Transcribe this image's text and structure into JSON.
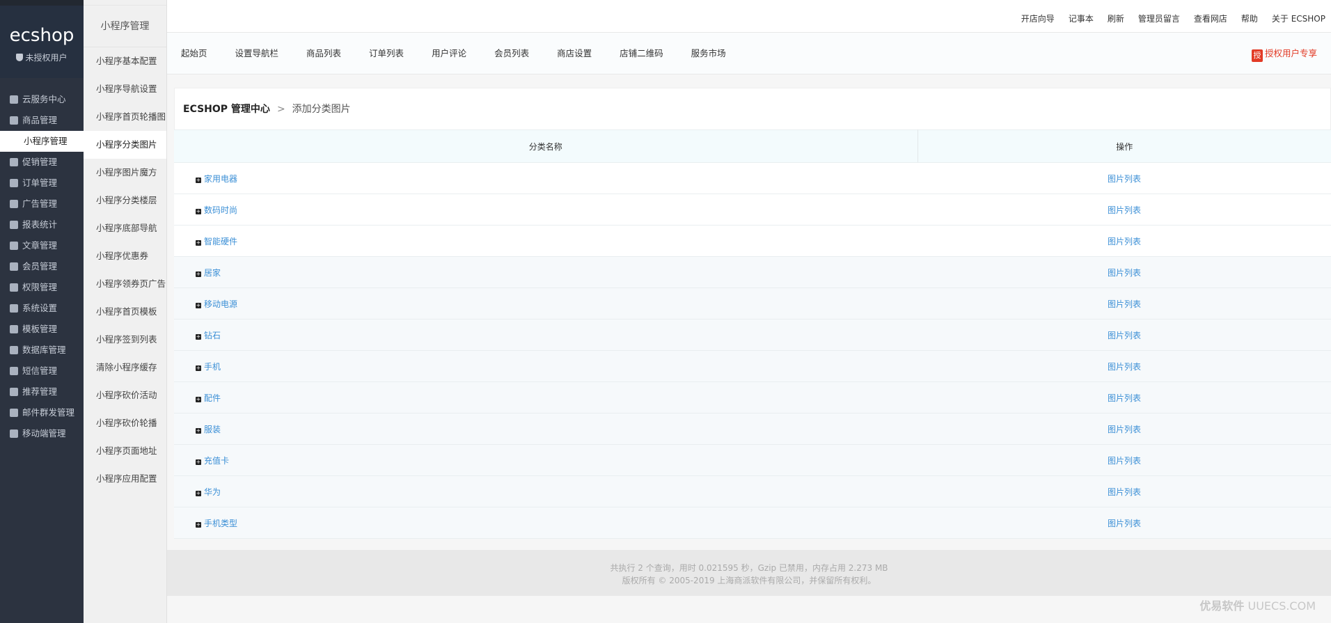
{
  "sidebar": {
    "logo": "ecshop",
    "user": "未授权用户",
    "items": [
      {
        "label": "云服务中心",
        "icon": "cloud-icon"
      },
      {
        "label": "商品管理",
        "icon": "goods-icon"
      },
      {
        "label": "小程序管理",
        "icon": "miniprogram-icon",
        "active": true
      },
      {
        "label": "促销管理",
        "icon": "promotion-icon"
      },
      {
        "label": "订单管理",
        "icon": "order-icon"
      },
      {
        "label": "广告管理",
        "icon": "ad-icon"
      },
      {
        "label": "报表统计",
        "icon": "chart-icon"
      },
      {
        "label": "文章管理",
        "icon": "article-icon"
      },
      {
        "label": "会员管理",
        "icon": "user-icon"
      },
      {
        "label": "权限管理",
        "icon": "lock-icon"
      },
      {
        "label": "系统设置",
        "icon": "gear-icon"
      },
      {
        "label": "模板管理",
        "icon": "template-icon"
      },
      {
        "label": "数据库管理",
        "icon": "database-icon"
      },
      {
        "label": "短信管理",
        "icon": "mail-icon"
      },
      {
        "label": "推荐管理",
        "icon": "thumb-icon"
      },
      {
        "label": "邮件群发管理",
        "icon": "send-icon"
      },
      {
        "label": "移动端管理",
        "icon": "mobile-icon"
      }
    ]
  },
  "submenu": {
    "title": "小程序管理",
    "items": [
      {
        "label": "小程序基本配置"
      },
      {
        "label": "小程序导航设置"
      },
      {
        "label": "小程序首页轮播图"
      },
      {
        "label": "小程序分类图片",
        "active": true
      },
      {
        "label": "小程序图片魔方"
      },
      {
        "label": "小程序分类楼层"
      },
      {
        "label": "小程序底部导航"
      },
      {
        "label": "小程序优惠券"
      },
      {
        "label": "小程序领券页广告"
      },
      {
        "label": "小程序首页模板"
      },
      {
        "label": "小程序签到列表"
      },
      {
        "label": "清除小程序缓存"
      },
      {
        "label": "小程序砍价活动"
      },
      {
        "label": "小程序砍价轮播"
      },
      {
        "label": "小程序页面地址"
      },
      {
        "label": "小程序应用配置"
      }
    ]
  },
  "topbar": [
    "开店向导",
    "记事本",
    "刷新",
    "管理员留言",
    "查看网店",
    "帮助",
    "关于 ECSHOP"
  ],
  "menubar": {
    "items": [
      "起始页",
      "设置导航栏",
      "商品列表",
      "订单列表",
      "用户评论",
      "会员列表",
      "商店设置",
      "店铺二维码",
      "服务市场"
    ],
    "auth_badge": "授",
    "auth_label": "授权用户专享"
  },
  "breadcrumb": {
    "root": "ECSHOP 管理中心",
    "sep": ">",
    "current": "添加分类图片"
  },
  "table": {
    "headers": [
      "分类名称",
      "操作"
    ],
    "rows": [
      {
        "name": "家用电器",
        "action": "图片列表"
      },
      {
        "name": "数码时尚",
        "action": "图片列表"
      },
      {
        "name": "智能硬件",
        "action": "图片列表"
      },
      {
        "name": "居家",
        "action": "图片列表"
      },
      {
        "name": "移动电源",
        "action": "图片列表"
      },
      {
        "name": "钻石",
        "action": "图片列表"
      },
      {
        "name": "手机",
        "action": "图片列表"
      },
      {
        "name": "配件",
        "action": "图片列表"
      },
      {
        "name": "服装",
        "action": "图片列表"
      },
      {
        "name": "充值卡",
        "action": "图片列表"
      },
      {
        "name": "华为",
        "action": "图片列表"
      },
      {
        "name": "手机类型",
        "action": "图片列表"
      }
    ]
  },
  "footer": {
    "line1": "共执行 2 个查询，用时 0.021595 秒，Gzip 已禁用，内存占用 2.273 MB",
    "line2": "版权所有 © 2005-2019 上海商派软件有限公司，并保留所有权利。"
  },
  "watermark": {
    "brand": "优易软件",
    "domain": "UUECS.COM"
  }
}
